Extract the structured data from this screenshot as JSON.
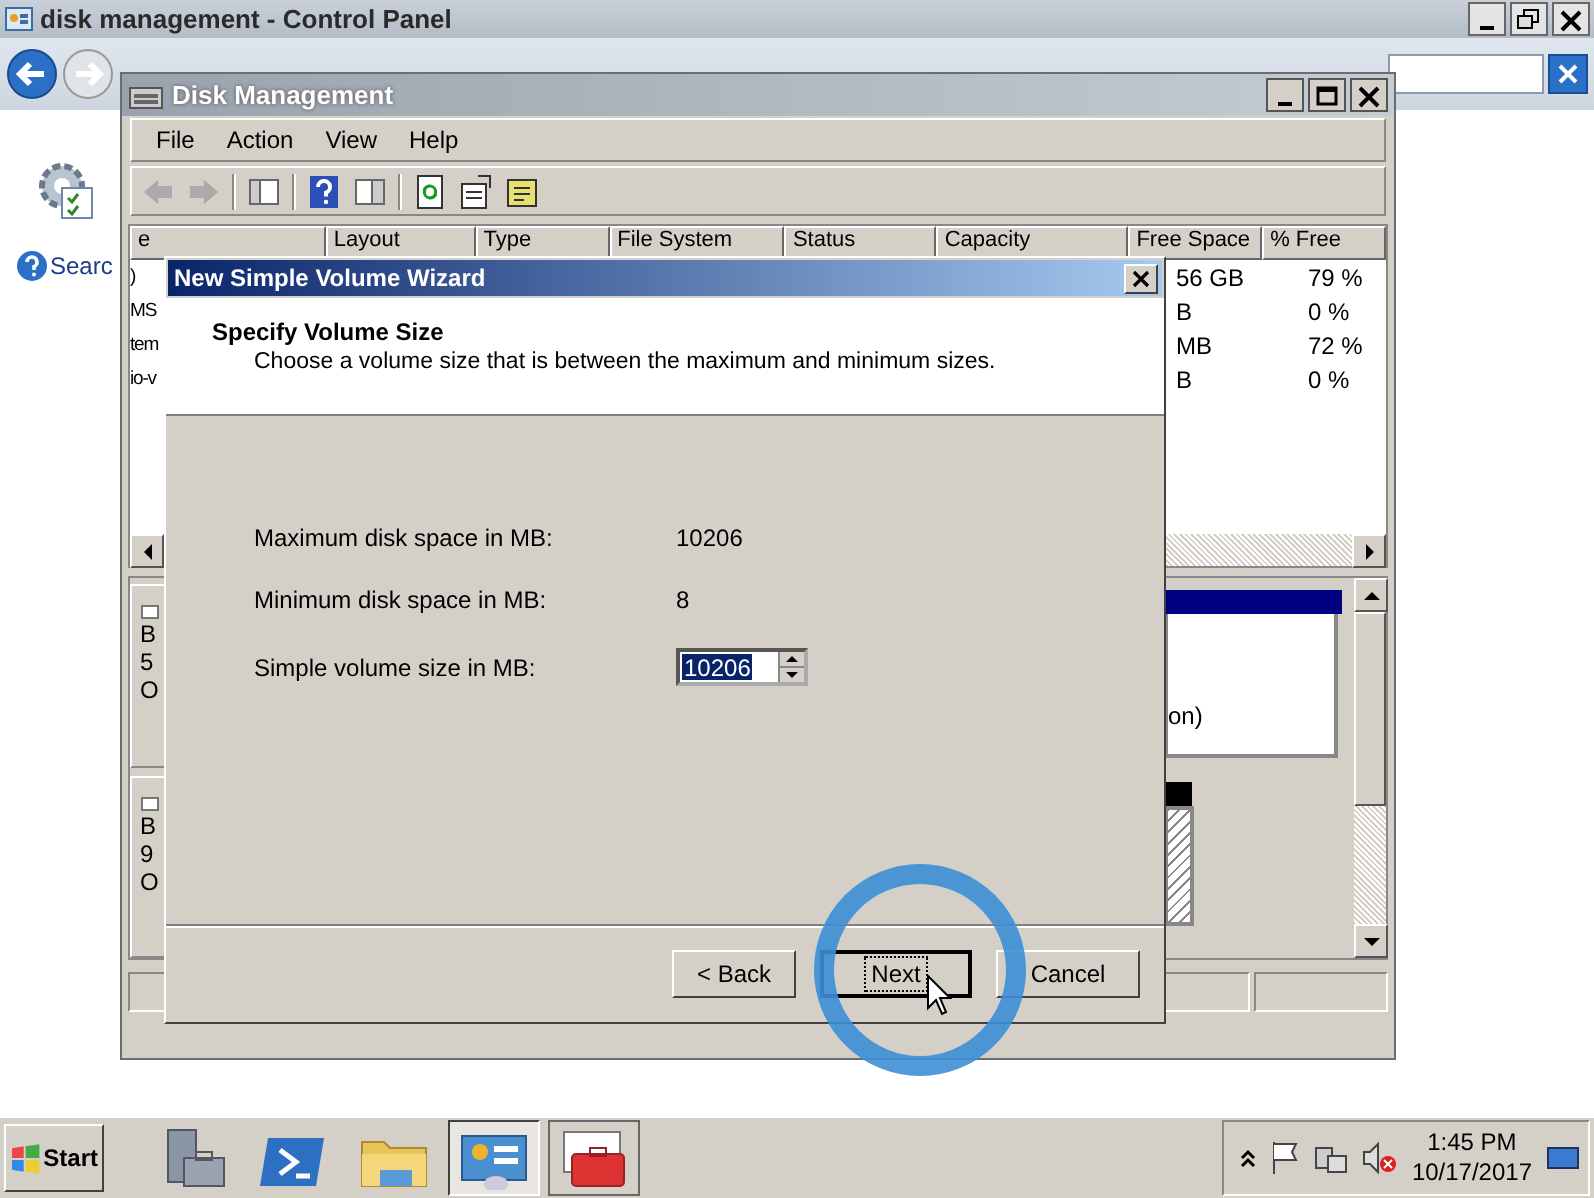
{
  "control_panel": {
    "title": "disk management - Control Panel",
    "search_link": "Searc"
  },
  "disk_management": {
    "title": "Disk Management",
    "menu": [
      "File",
      "Action",
      "View",
      "Help"
    ],
    "columns": [
      "e",
      "Layout",
      "Type",
      "File System",
      "Status",
      "Capacity",
      "Free Space",
      "% Free"
    ],
    "rows": [
      {
        "column_1": ")",
        "free_space": "56 GB",
        "percent_free": "79 %"
      },
      {
        "column_1": "MS",
        "free_space": "B",
        "percent_free": "0 %"
      },
      {
        "column_1": "tem",
        "free_space": "MB",
        "percent_free": "72 %"
      },
      {
        "column_1": "io-v",
        "free_space": "B",
        "percent_free": "0 %"
      }
    ],
    "disks": [
      {
        "lines": [
          "B",
          "5",
          "O"
        ]
      },
      {
        "lines": [
          "B",
          "9",
          "O"
        ]
      }
    ],
    "volume_fragment": "on)"
  },
  "wizard": {
    "title": "New Simple Volume Wizard",
    "heading": "Specify Volume Size",
    "subtitle": "Choose a volume size that is between the maximum and minimum sizes.",
    "fields": [
      {
        "kind": "text",
        "label": "Maximum disk space in MB:",
        "value": "10206"
      },
      {
        "kind": "text",
        "label": "Minimum disk space in MB:",
        "value": "8"
      },
      {
        "kind": "spin",
        "label": "Simple volume size in MB:",
        "value": "10206"
      }
    ],
    "buttons": [
      {
        "label": "< Back",
        "focused": false
      },
      {
        "label": "Next",
        "focused": true
      },
      {
        "label": "Cancel",
        "focused": false
      }
    ]
  },
  "taskbar": {
    "start": "Start",
    "time": "1:45 PM",
    "date": "10/17/2017"
  }
}
